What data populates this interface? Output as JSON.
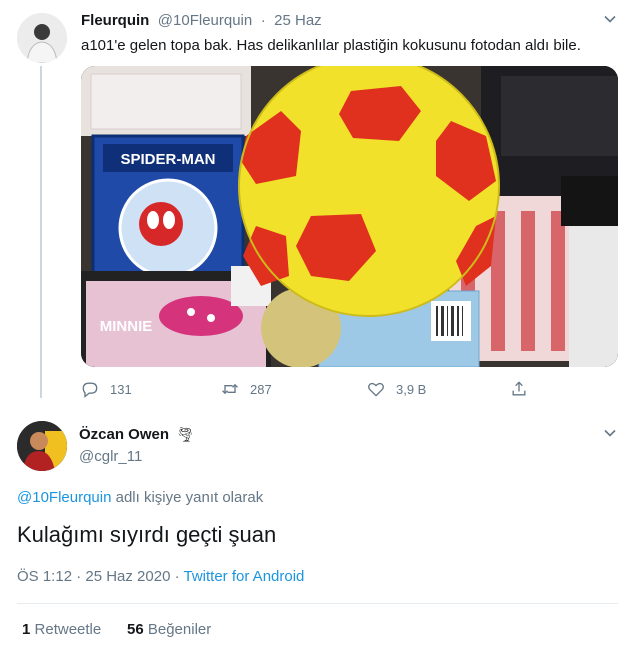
{
  "tweet1": {
    "display_name": "Fleurquin",
    "handle": "@10Fleurquin",
    "dot": "·",
    "time": "25 Haz",
    "text": "a101'e gelen topa bak. Has delikanlılar plastiğin kokusunu fotodan aldı bile.",
    "actions": {
      "replies": "131",
      "retweets": "287",
      "likes": "3,9 B"
    },
    "media": {
      "spiderman_box_title": "SPIDER-MAN",
      "minnie_label": "MINNIE",
      "ball_colors": {
        "primary": "#f2e12a",
        "panels": "#e0301e"
      }
    }
  },
  "tweet2": {
    "display_name": "Özcan Owen",
    "name_emoji": "🌪",
    "handle": "@cglr_11",
    "reply_to_handle": "@10Fleurquin",
    "reply_to_suffix": " adlı kişiye yanıt olarak",
    "text": "Kulağımı sıyırdı geçti şuan",
    "time": "ÖS 1:12 · 25 Haz 2020",
    "dot": " · ",
    "source": "Twitter for Android",
    "stats": {
      "retweets_count": "1",
      "retweets_label": "Retweetle",
      "likes_count": "56",
      "likes_label": "Beğeniler"
    }
  },
  "colors": {
    "link": "#1b95e0",
    "muted": "#657786",
    "text": "#14171a"
  }
}
